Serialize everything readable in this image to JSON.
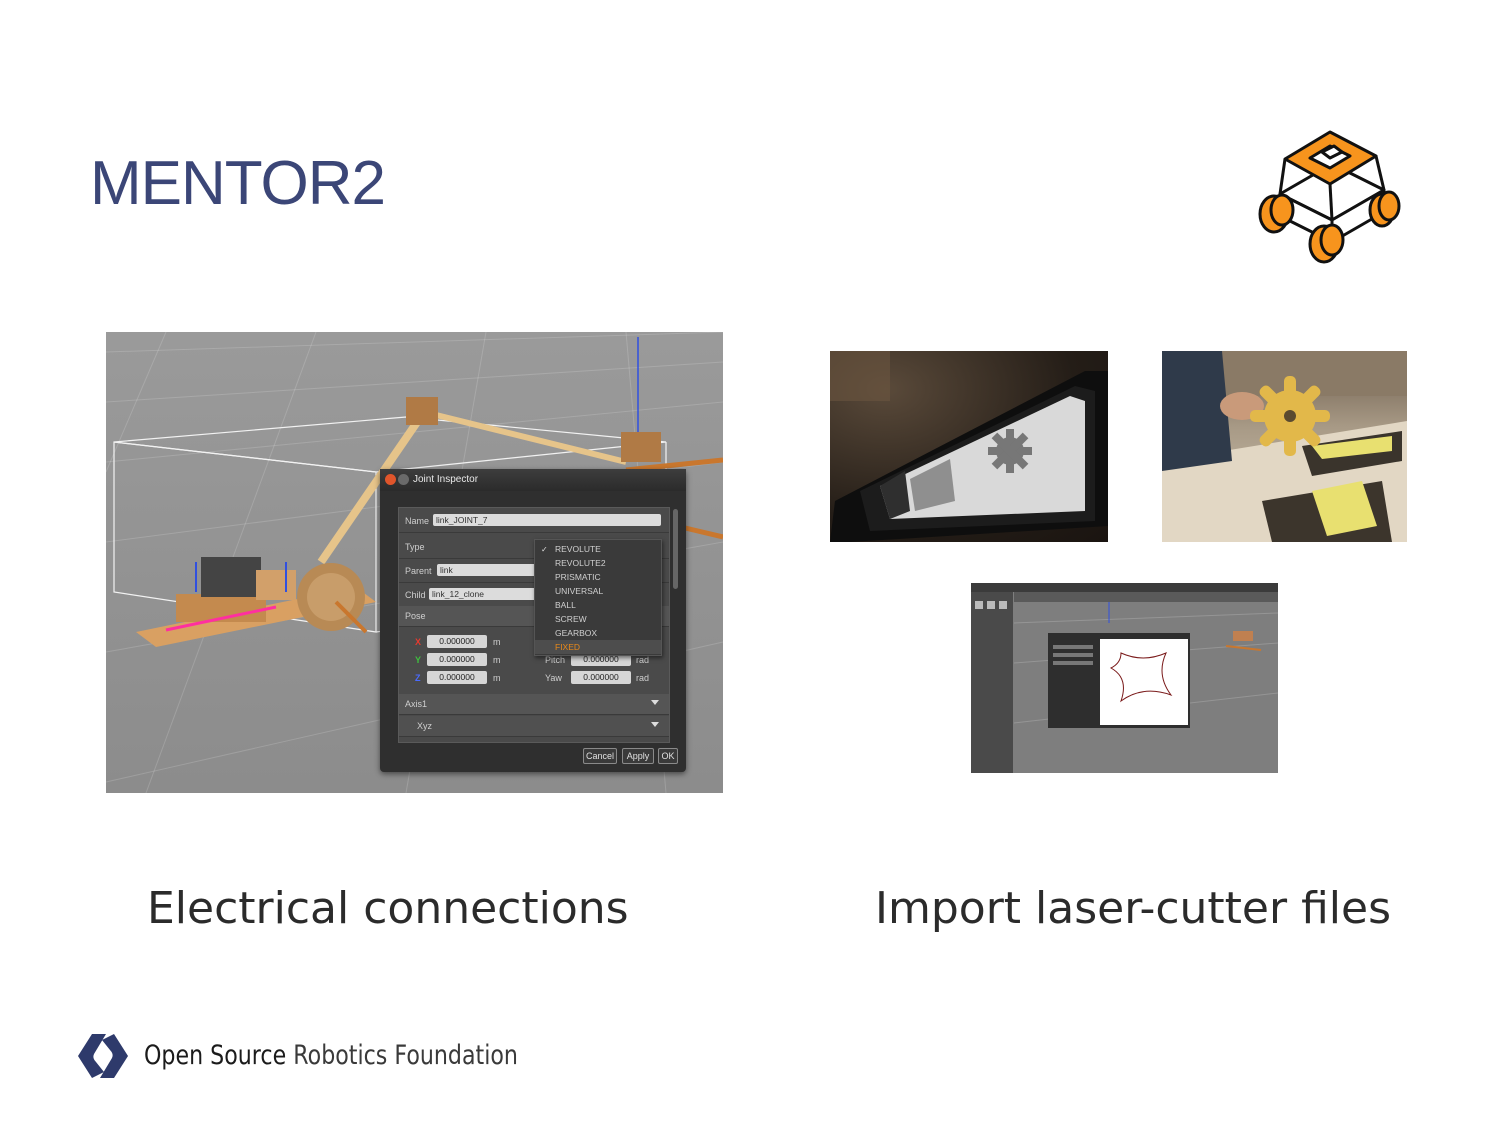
{
  "slide": {
    "title": "MENTOR2",
    "left_caption": "Electrical connections",
    "right_caption": "Import laser-cutter files",
    "footer": {
      "brand_bold": "Open Source",
      "brand_light": "Robotics Foundation"
    }
  },
  "joint_inspector": {
    "window_title": "Joint Inspector",
    "name_label": "Name",
    "name_value": "link_JOINT_7",
    "type_label": "Type",
    "parent_label": "Parent",
    "parent_value": "link",
    "child_label": "Child",
    "child_value": "link_12_clone",
    "pose_label": "Pose",
    "x_label": "X",
    "y_label": "Y",
    "z_label": "Z",
    "x_value": "0.000000",
    "y_value": "0.000000",
    "z_value": "0.000000",
    "linear_unit": "m",
    "pitch_label": "Pitch",
    "pitch_value": "0.000000",
    "yaw_label": "Yaw",
    "yaw_value": "0.000000",
    "angular_unit": "rad",
    "axis1_label": "Axis1",
    "xyz_label": "Xyz",
    "type_options": [
      "REVOLUTE",
      "REVOLUTE2",
      "PRISMATIC",
      "UNIVERSAL",
      "BALL",
      "SCREW",
      "GEARBOX",
      "FIXED"
    ],
    "selected_option": "REVOLUTE",
    "highlighted_option": "FIXED",
    "cancel_label": "Cancel",
    "apply_label": "Apply",
    "ok_label": "OK"
  },
  "colors": {
    "title": "#3b4677",
    "logo_orange": "#f7941d",
    "highlight": "#e8891a",
    "brand_navy": "#2e3a6b"
  }
}
